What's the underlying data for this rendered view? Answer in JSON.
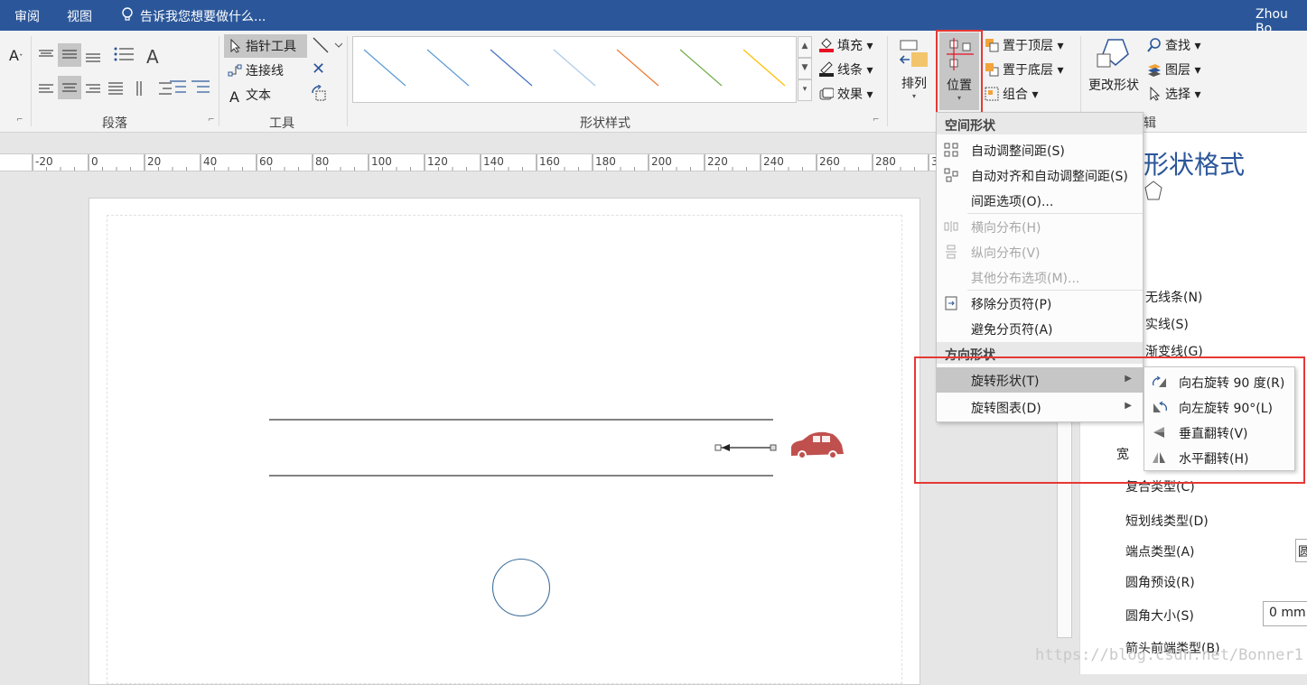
{
  "titlebar": {
    "tab_review": "审阅",
    "tab_view": "视图",
    "tellme": "告诉我您想要做什么...",
    "user": "Zhou Bo"
  },
  "ribbon": {
    "groups": {
      "paragraph": "段落",
      "tools": "工具",
      "shape_styles": "形状样式",
      "edit": "辑"
    },
    "tools": {
      "pointer": "指针工具",
      "connector": "连接线",
      "text": "文本"
    },
    "style_options": {
      "fill": "填充",
      "line": "线条",
      "effect": "效果"
    },
    "arrange": {
      "arrange_label": "排列",
      "position_label": "位置",
      "bring_front": "置于顶层",
      "send_back": "置于底层",
      "group": "组合",
      "change_shape": "更改形状",
      "find": "查找",
      "layers": "图层",
      "select": "选择"
    },
    "style_colors": [
      "#5b9bd5",
      "#5b9bd5",
      "#4472c4",
      "#a5c8e8",
      "#ed7d31",
      "#70ad47",
      "#ffc000"
    ]
  },
  "ruler": {
    "labels": [
      "-20",
      "0",
      "20",
      "40",
      "60",
      "80",
      "100",
      "120",
      "140",
      "160",
      "180",
      "200",
      "220",
      "240",
      "260",
      "280",
      "3"
    ]
  },
  "canvas": {
    "car_color": "#c0504d",
    "line_color": "#595959",
    "circle_color": "#41719c"
  },
  "right_pane": {
    "title": "形状格式",
    "items": [
      "无线条(N)",
      "实线(S)",
      "渐变线(G)",
      "宽",
      "复合类型(C)",
      "短划线类型(D)",
      "端点类型(A)",
      "圆角预设(R)",
      "圆角大小(S)",
      "箭头前端类型(B)"
    ],
    "corner_value": "0 mm",
    "cap_value": "圆",
    "partial": "颜"
  },
  "menu": {
    "header1": "空间形状",
    "items1": [
      {
        "label": "自动调整间距(S)",
        "disabled": false
      },
      {
        "label": "自动对齐和自动调整间距(S)",
        "disabled": false
      },
      {
        "label": "间距选项(O)...",
        "disabled": false
      },
      {
        "label": "横向分布(H)",
        "disabled": true
      },
      {
        "label": "纵向分布(V)",
        "disabled": true
      },
      {
        "label": "其他分布选项(M)...",
        "disabled": true
      },
      {
        "label": "移除分页符(P)",
        "disabled": false
      },
      {
        "label": "避免分页符(A)",
        "disabled": false
      }
    ],
    "header2": "方向形状",
    "rotate_shape": "旋转形状(T)",
    "rotate_chart": "旋转图表(D)"
  },
  "submenu": {
    "items": [
      "向右旋转 90 度(R)",
      "向左旋转 90°(L)",
      "垂直翻转(V)",
      "水平翻转(H)"
    ]
  },
  "watermark": "https://blog.csdn.net/Bonner1"
}
